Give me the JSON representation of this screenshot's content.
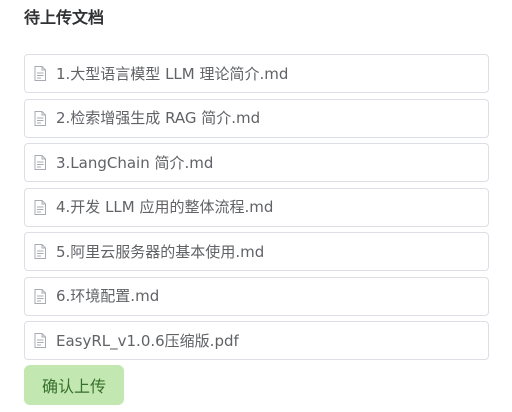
{
  "panel": {
    "title": "待上传文档"
  },
  "files": [
    {
      "name": "1.大型语言模型 LLM 理论简介.md",
      "icon": "document-icon"
    },
    {
      "name": "2.检索增强生成 RAG 简介.md",
      "icon": "document-icon"
    },
    {
      "name": "3.LangChain 简介.md",
      "icon": "document-icon"
    },
    {
      "name": "4.开发 LLM 应用的整体流程.md",
      "icon": "document-icon"
    },
    {
      "name": "5.阿里云服务器的基本使用.md",
      "icon": "document-icon"
    },
    {
      "name": "6.环境配置.md",
      "icon": "document-icon"
    },
    {
      "name": "EasyRL_v1.0.6压缩版.pdf",
      "icon": "document-icon"
    }
  ],
  "actions": {
    "confirm_label": "确认上传"
  },
  "colors": {
    "confirm_bg": "#c2e7b0",
    "confirm_text": "#37702c",
    "border": "#dcdfe6",
    "icon": "#a8abb2"
  }
}
